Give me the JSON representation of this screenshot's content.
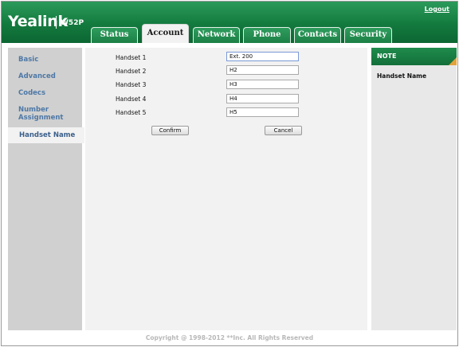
{
  "header": {
    "logo": "Yealink",
    "model": "W52P",
    "logout": "Logout"
  },
  "tabs": [
    {
      "label": "Status"
    },
    {
      "label": "Account"
    },
    {
      "label": "Network"
    },
    {
      "label": "Phone"
    },
    {
      "label": "Contacts"
    },
    {
      "label": "Security"
    }
  ],
  "active_tab": "Account",
  "sidebar": {
    "items": [
      {
        "label": "Basic"
      },
      {
        "label": "Advanced"
      },
      {
        "label": "Codecs"
      },
      {
        "label_line1": "Number",
        "label_line2": "Assignment"
      },
      {
        "label": "Handset Name"
      }
    ],
    "active": "Handset Name"
  },
  "form": {
    "rows": [
      {
        "label": "Handset 1",
        "value": "Ext. 200"
      },
      {
        "label": "Handset 2",
        "value": "H2"
      },
      {
        "label": "Handset 3",
        "value": "H3"
      },
      {
        "label": "Handset 4",
        "value": "H4"
      },
      {
        "label": "Handset 5",
        "value": "H5"
      }
    ],
    "confirm_label": "Confirm",
    "cancel_label": "Cancel"
  },
  "note": {
    "title": "NOTE",
    "body": "Handset Name"
  },
  "footer": {
    "copyright": "Copyright @ 1998-2012 **Inc. All Rights Reserved"
  },
  "colors": {
    "brand_green": "#137a3e",
    "note_accent": "#e3a23a",
    "sidebar_link": "#4e78a6"
  }
}
